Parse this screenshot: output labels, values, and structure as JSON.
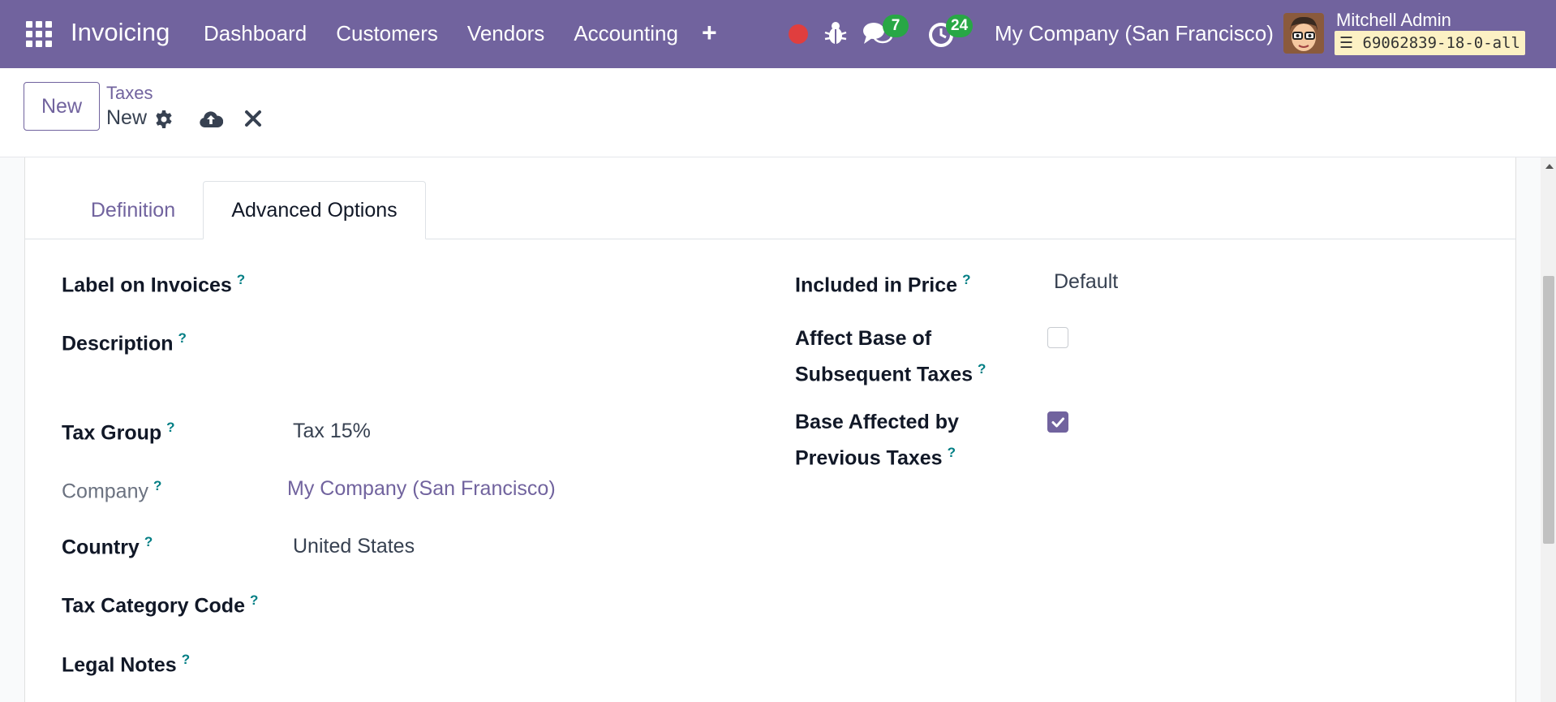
{
  "navbar": {
    "app_name": "Invoicing",
    "menu": [
      "Dashboard",
      "Customers",
      "Vendors",
      "Accounting"
    ],
    "chat_count": "7",
    "activity_count": "24",
    "company": "My Company (San Francisco)",
    "user_name": "Mitchell Admin",
    "database": "69062839-18-0-all",
    "brand_color": "#71639e"
  },
  "control_panel": {
    "new_label": "New",
    "breadcrumb_parent": "Taxes",
    "breadcrumb_current": "New"
  },
  "tabs": [
    {
      "label": "Definition",
      "active": false
    },
    {
      "label": "Advanced Options",
      "active": true
    }
  ],
  "form": {
    "label_on_invoices": {
      "label": "Label on Invoices",
      "value": ""
    },
    "description": {
      "label": "Description",
      "value": ""
    },
    "tax_group": {
      "label": "Tax Group",
      "value": "Tax 15%"
    },
    "company": {
      "label": "Company",
      "value": "My Company (San Francisco)"
    },
    "country": {
      "label": "Country",
      "value": "United States"
    },
    "tax_category_code": {
      "label": "Tax Category Code",
      "value": ""
    },
    "legal_notes": {
      "label": "Legal Notes",
      "value": ""
    },
    "included_in_price": {
      "label": "Included in Price",
      "value": "Default"
    },
    "affect_base": {
      "label_line1": "Affect Base of",
      "label_line2": "Subsequent Taxes",
      "checked": false
    },
    "base_affected": {
      "label_line1": "Base Affected by",
      "label_line2": "Previous Taxes",
      "checked": true
    }
  },
  "help_mark": "?",
  "icons": [
    "apps-grid-icon",
    "plus-icon",
    "record-icon",
    "bug-icon",
    "chat-icon",
    "clock-icon",
    "database-icon",
    "gear-icon",
    "cloud-upload-icon",
    "close-icon",
    "check-icon"
  ]
}
